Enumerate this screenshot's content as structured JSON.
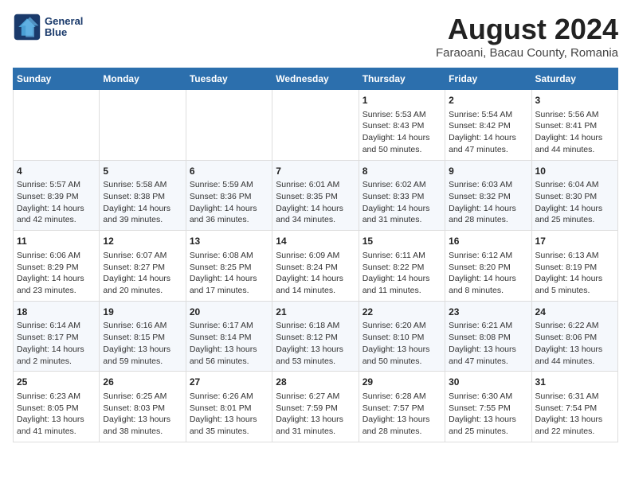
{
  "logo": {
    "line1": "General",
    "line2": "Blue"
  },
  "title": "August 2024",
  "subtitle": "Faraoani, Bacau County, Romania",
  "weekdays": [
    "Sunday",
    "Monday",
    "Tuesday",
    "Wednesday",
    "Thursday",
    "Friday",
    "Saturday"
  ],
  "rows": [
    [
      {
        "day": "",
        "info": ""
      },
      {
        "day": "",
        "info": ""
      },
      {
        "day": "",
        "info": ""
      },
      {
        "day": "",
        "info": ""
      },
      {
        "day": "1",
        "info": "Sunrise: 5:53 AM\nSunset: 8:43 PM\nDaylight: 14 hours and 50 minutes."
      },
      {
        "day": "2",
        "info": "Sunrise: 5:54 AM\nSunset: 8:42 PM\nDaylight: 14 hours and 47 minutes."
      },
      {
        "day": "3",
        "info": "Sunrise: 5:56 AM\nSunset: 8:41 PM\nDaylight: 14 hours and 44 minutes."
      }
    ],
    [
      {
        "day": "4",
        "info": "Sunrise: 5:57 AM\nSunset: 8:39 PM\nDaylight: 14 hours and 42 minutes."
      },
      {
        "day": "5",
        "info": "Sunrise: 5:58 AM\nSunset: 8:38 PM\nDaylight: 14 hours and 39 minutes."
      },
      {
        "day": "6",
        "info": "Sunrise: 5:59 AM\nSunset: 8:36 PM\nDaylight: 14 hours and 36 minutes."
      },
      {
        "day": "7",
        "info": "Sunrise: 6:01 AM\nSunset: 8:35 PM\nDaylight: 14 hours and 34 minutes."
      },
      {
        "day": "8",
        "info": "Sunrise: 6:02 AM\nSunset: 8:33 PM\nDaylight: 14 hours and 31 minutes."
      },
      {
        "day": "9",
        "info": "Sunrise: 6:03 AM\nSunset: 8:32 PM\nDaylight: 14 hours and 28 minutes."
      },
      {
        "day": "10",
        "info": "Sunrise: 6:04 AM\nSunset: 8:30 PM\nDaylight: 14 hours and 25 minutes."
      }
    ],
    [
      {
        "day": "11",
        "info": "Sunrise: 6:06 AM\nSunset: 8:29 PM\nDaylight: 14 hours and 23 minutes."
      },
      {
        "day": "12",
        "info": "Sunrise: 6:07 AM\nSunset: 8:27 PM\nDaylight: 14 hours and 20 minutes."
      },
      {
        "day": "13",
        "info": "Sunrise: 6:08 AM\nSunset: 8:25 PM\nDaylight: 14 hours and 17 minutes."
      },
      {
        "day": "14",
        "info": "Sunrise: 6:09 AM\nSunset: 8:24 PM\nDaylight: 14 hours and 14 minutes."
      },
      {
        "day": "15",
        "info": "Sunrise: 6:11 AM\nSunset: 8:22 PM\nDaylight: 14 hours and 11 minutes."
      },
      {
        "day": "16",
        "info": "Sunrise: 6:12 AM\nSunset: 8:20 PM\nDaylight: 14 hours and 8 minutes."
      },
      {
        "day": "17",
        "info": "Sunrise: 6:13 AM\nSunset: 8:19 PM\nDaylight: 14 hours and 5 minutes."
      }
    ],
    [
      {
        "day": "18",
        "info": "Sunrise: 6:14 AM\nSunset: 8:17 PM\nDaylight: 14 hours and 2 minutes."
      },
      {
        "day": "19",
        "info": "Sunrise: 6:16 AM\nSunset: 8:15 PM\nDaylight: 13 hours and 59 minutes."
      },
      {
        "day": "20",
        "info": "Sunrise: 6:17 AM\nSunset: 8:14 PM\nDaylight: 13 hours and 56 minutes."
      },
      {
        "day": "21",
        "info": "Sunrise: 6:18 AM\nSunset: 8:12 PM\nDaylight: 13 hours and 53 minutes."
      },
      {
        "day": "22",
        "info": "Sunrise: 6:20 AM\nSunset: 8:10 PM\nDaylight: 13 hours and 50 minutes."
      },
      {
        "day": "23",
        "info": "Sunrise: 6:21 AM\nSunset: 8:08 PM\nDaylight: 13 hours and 47 minutes."
      },
      {
        "day": "24",
        "info": "Sunrise: 6:22 AM\nSunset: 8:06 PM\nDaylight: 13 hours and 44 minutes."
      }
    ],
    [
      {
        "day": "25",
        "info": "Sunrise: 6:23 AM\nSunset: 8:05 PM\nDaylight: 13 hours and 41 minutes."
      },
      {
        "day": "26",
        "info": "Sunrise: 6:25 AM\nSunset: 8:03 PM\nDaylight: 13 hours and 38 minutes."
      },
      {
        "day": "27",
        "info": "Sunrise: 6:26 AM\nSunset: 8:01 PM\nDaylight: 13 hours and 35 minutes."
      },
      {
        "day": "28",
        "info": "Sunrise: 6:27 AM\nSunset: 7:59 PM\nDaylight: 13 hours and 31 minutes."
      },
      {
        "day": "29",
        "info": "Sunrise: 6:28 AM\nSunset: 7:57 PM\nDaylight: 13 hours and 28 minutes."
      },
      {
        "day": "30",
        "info": "Sunrise: 6:30 AM\nSunset: 7:55 PM\nDaylight: 13 hours and 25 minutes."
      },
      {
        "day": "31",
        "info": "Sunrise: 6:31 AM\nSunset: 7:54 PM\nDaylight: 13 hours and 22 minutes."
      }
    ]
  ]
}
